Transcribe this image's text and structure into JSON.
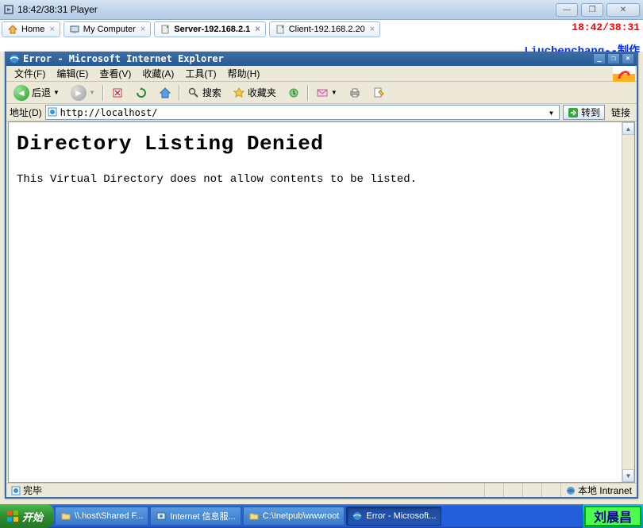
{
  "player": {
    "title": "18:42/38:31 Player",
    "overlay_time": "18:42/38:31",
    "overlay_author": "Liuchenchang--制作",
    "tabs": [
      {
        "label": "Home",
        "close": "×"
      },
      {
        "label": "My Computer",
        "close": "×"
      },
      {
        "label": "Server-192.168.2.1",
        "close": "×"
      },
      {
        "label": "Client-192.168.2.20",
        "close": "×"
      }
    ]
  },
  "ie": {
    "title": "Error - Microsoft Internet Explorer",
    "menu": {
      "file": "文件(F)",
      "edit": "编辑(E)",
      "view": "查看(V)",
      "fav": "收藏(A)",
      "tools": "工具(T)",
      "help": "帮助(H)"
    },
    "toolbar": {
      "back": "后退",
      "search": "搜索",
      "favorites": "收藏夹"
    },
    "address": {
      "label": "地址(D)",
      "url": "http://localhost/",
      "go": "转到",
      "links": "链接"
    },
    "page": {
      "heading": "Directory Listing Denied",
      "body": "This Virtual Directory does not allow contents to be listed."
    },
    "status": {
      "done": "完毕",
      "zone": "本地 Intranet"
    }
  },
  "taskbar": {
    "start": "开始",
    "items": [
      "\\\\.host\\Shared F...",
      "Internet 信息服...",
      "C:\\Inetpub\\wwwroot",
      "Error - Microsoft..."
    ],
    "stamp": "刘晨昌"
  }
}
